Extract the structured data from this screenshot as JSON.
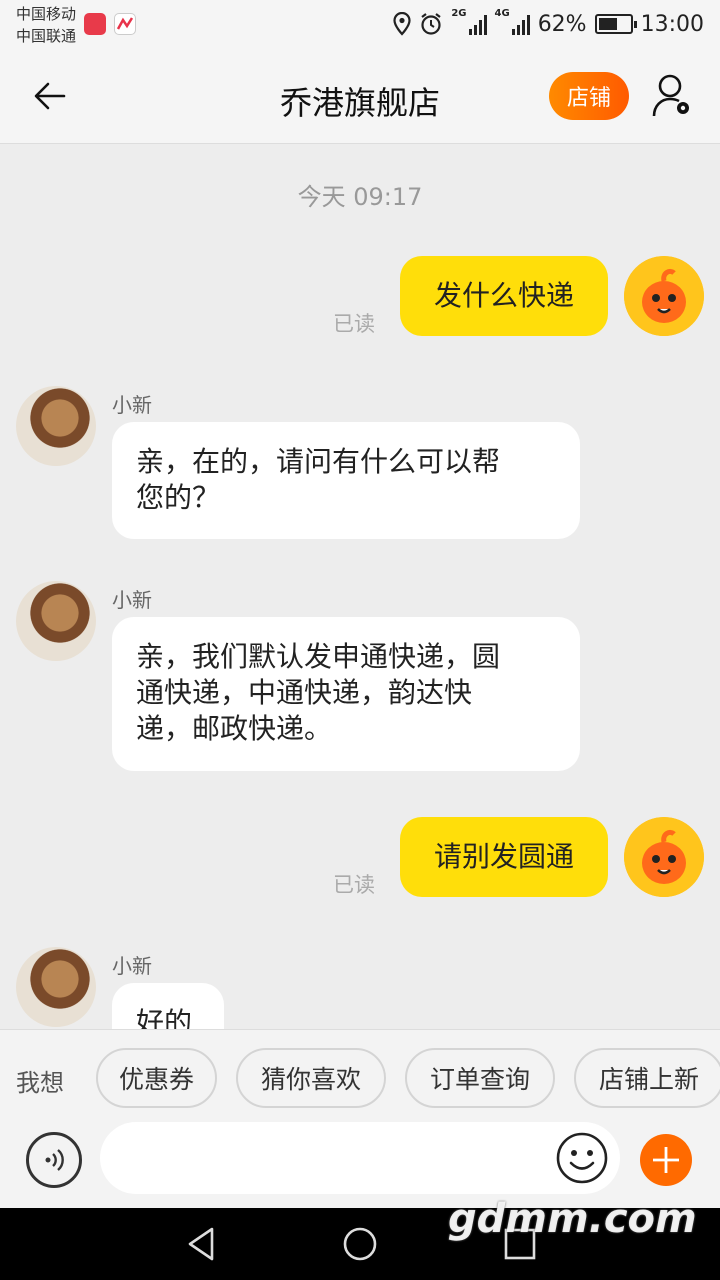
{
  "status_bar": {
    "carrier1": "中国移动",
    "carrier2": "中国联通",
    "net1": "2G",
    "net2": "4G",
    "battery_text": "62%",
    "battery_level": 0.62,
    "time": "13:00"
  },
  "header": {
    "title": "乔港旗舰店",
    "shop_label": "店铺"
  },
  "chat": {
    "timestamp": "今天  09:17",
    "messages": [
      {
        "from": "me",
        "text": "发什么快递",
        "status": "已读"
      },
      {
        "from": "them",
        "name": "小新",
        "text_line1": "亲，在的，请问有什么可以帮",
        "text_line2": "您的？"
      },
      {
        "from": "them",
        "name": "小新",
        "text_line1": "亲，我们默认发申通快递，圆",
        "text_line2": "通快递，中通快递，韵达快",
        "text_line3": "递，邮政快递。"
      },
      {
        "from": "me",
        "text": "请别发圆通",
        "status": "已读"
      },
      {
        "from": "them",
        "name": "小新",
        "text": "好的"
      }
    ]
  },
  "suggestions": {
    "label": "我想",
    "chips": [
      "优惠券",
      "猜你喜欢",
      "订单查询",
      "店铺上新"
    ]
  },
  "input": {
    "placeholder": ""
  },
  "watermark": "gdmm.com",
  "colors": {
    "accent": "#ff6a00",
    "my_bubble": "#ffde0a",
    "their_bubble": "#ffffff",
    "background": "#ededed"
  }
}
